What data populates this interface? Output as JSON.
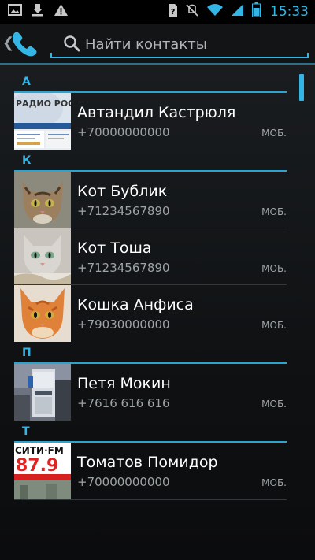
{
  "status_bar": {
    "time": "15:33",
    "left_icons": [
      "image-icon",
      "download-icon",
      "warning-icon"
    ],
    "right_icons": [
      "sim-icon",
      "silent-icon",
      "wifi-icon",
      "signal-icon",
      "battery-icon"
    ]
  },
  "action_bar": {
    "app_icon": "phone-icon",
    "search_placeholder": "Найти контакты",
    "search_value": ""
  },
  "sections": [
    {
      "letter": "А",
      "contacts": [
        {
          "name": "Автандил Кастрюля",
          "phone": "+70000000000",
          "type": "МОБ.",
          "photo": "radio-rossii-thumbnail"
        }
      ]
    },
    {
      "letter": "К",
      "contacts": [
        {
          "name": "Кот Бублик",
          "phone": "+71234567890",
          "type": "МОБ.",
          "photo": "tabby-cat-thumbnail"
        },
        {
          "name": "Кот Тоша",
          "phone": "+71234567890",
          "type": "МОБ.",
          "photo": "grey-cat-thumbnail"
        },
        {
          "name": "Кошка Анфиса",
          "phone": "+79030000000",
          "type": "МОБ.",
          "photo": "ginger-cat-thumbnail"
        }
      ]
    },
    {
      "letter": "П",
      "contacts": [
        {
          "name": "Петя Мокин",
          "phone": "+7616 616 616",
          "type": "МОБ.",
          "photo": "water-cooler-thumbnail"
        }
      ]
    },
    {
      "letter": "Т",
      "contacts": [
        {
          "name": "Томатов Помидор",
          "phone": "+70000000000",
          "type": "МОБ.",
          "photo": "citi-fm-thumbnail"
        }
      ]
    }
  ],
  "thumbnail_text": {
    "radio_rossii": "РАДИО РОССИИ",
    "citi_fm": "СИТИ·FM",
    "citi_freq": "87.9"
  },
  "colors": {
    "accent": "#33b5e5",
    "background": "#0f1113",
    "secondary_text": "#9ea3a6"
  }
}
